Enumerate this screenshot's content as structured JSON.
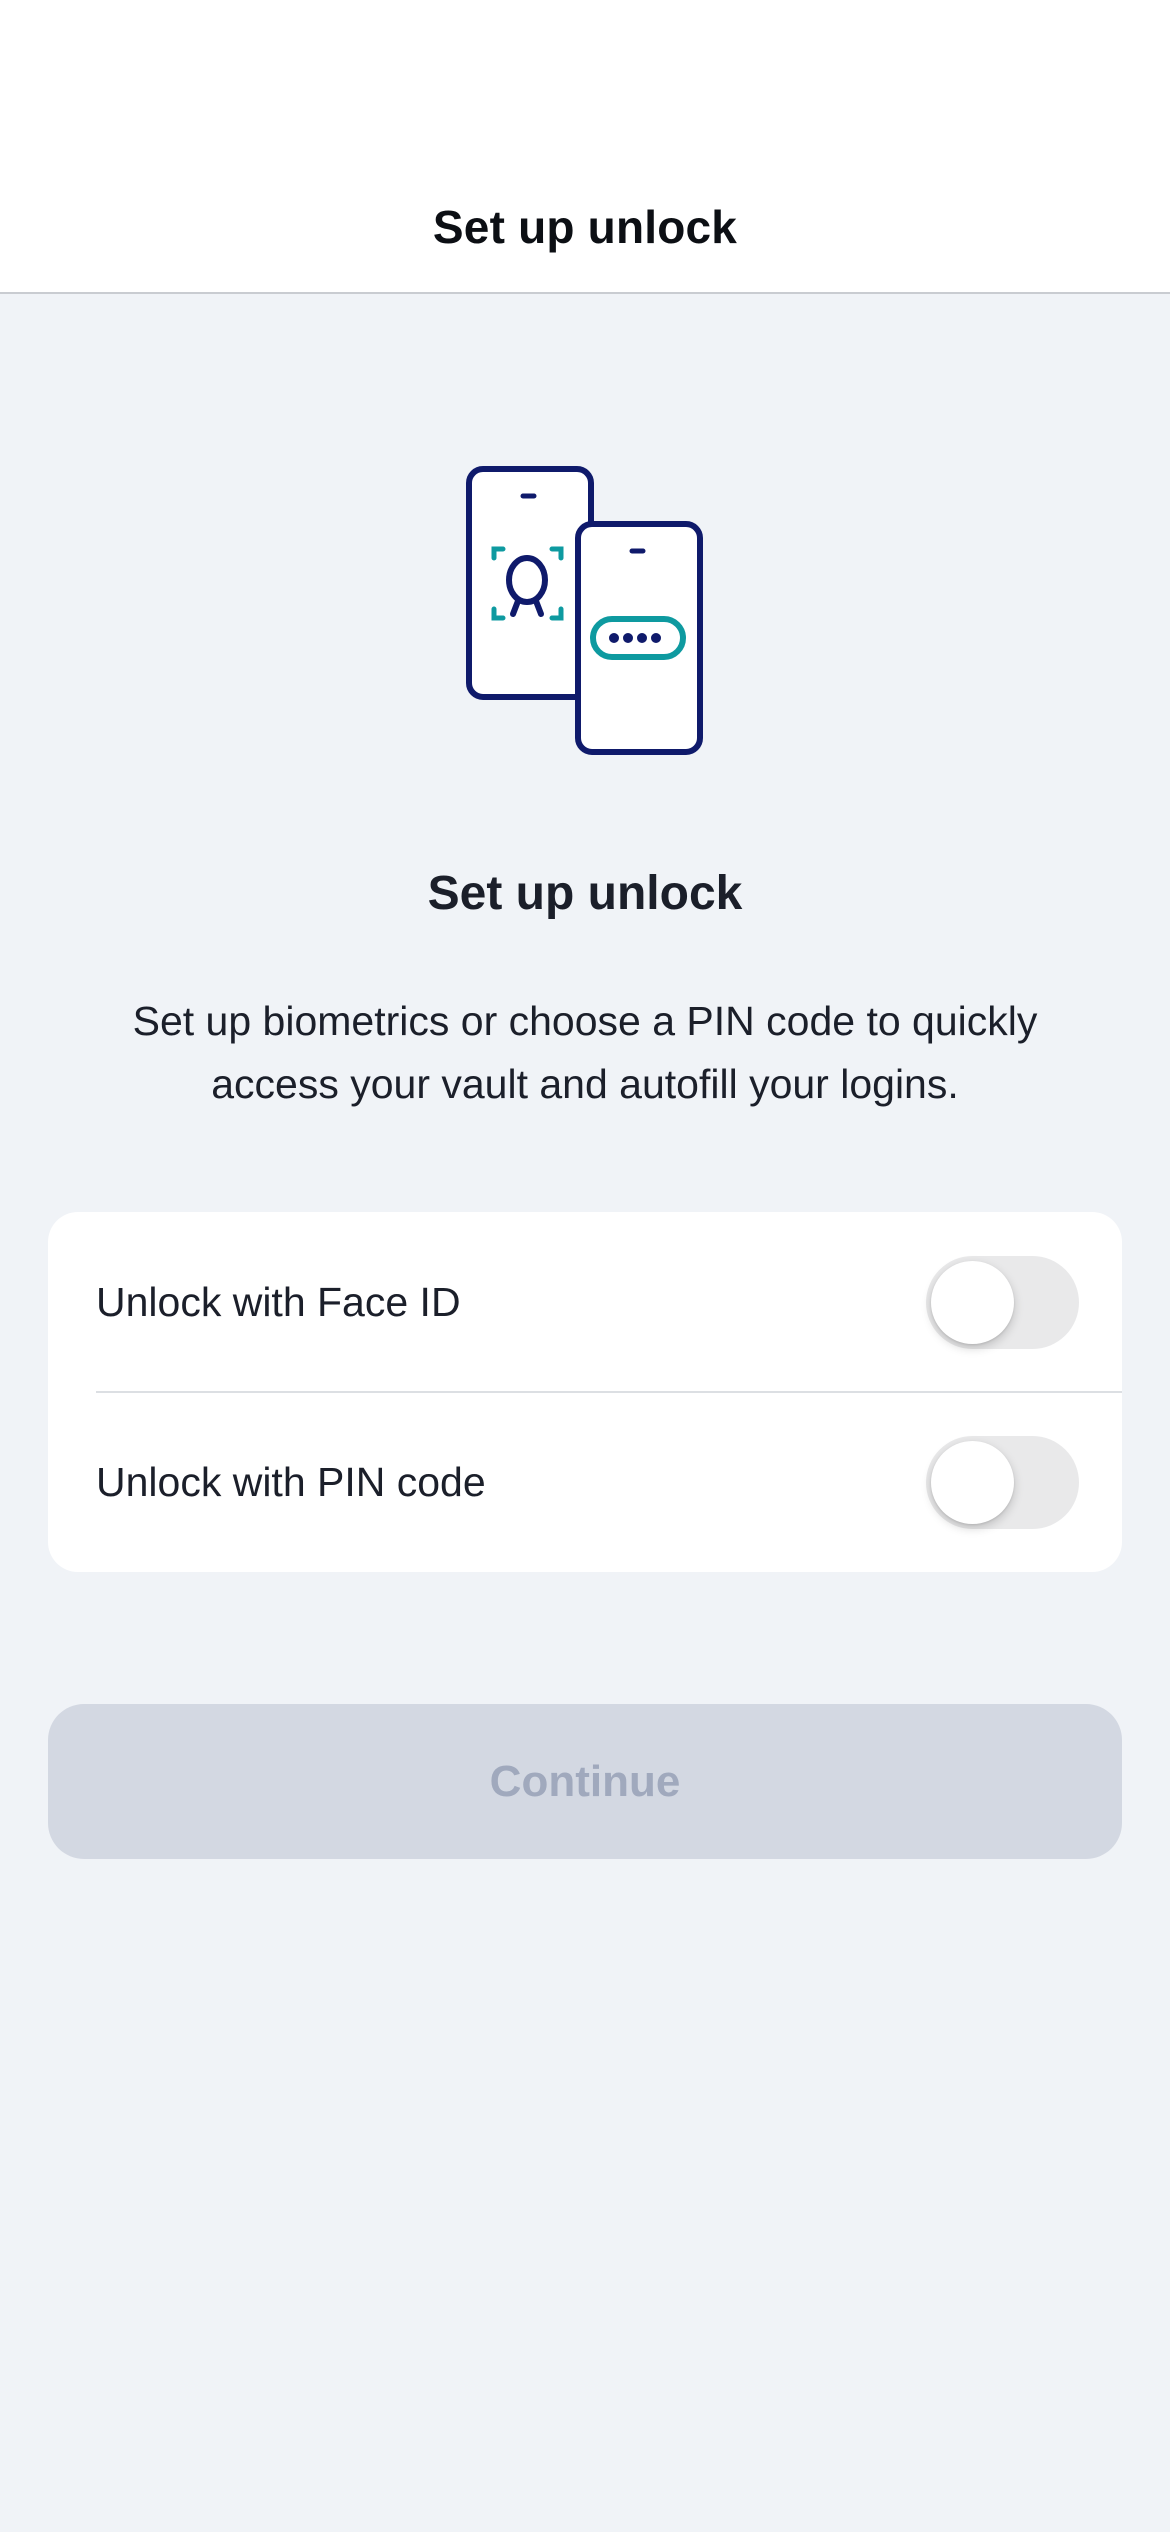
{
  "header": {
    "title": "Set up unlock"
  },
  "illustration": {
    "icon": "phones-biometric-pin-illustration",
    "colors": {
      "outline": "#0f1a6b",
      "accent": "#0e9aa0"
    }
  },
  "main": {
    "heading": "Set up unlock",
    "description": "Set up biometrics or choose a PIN code to quickly access your vault and autofill your logins."
  },
  "options": [
    {
      "label": "Unlock with Face ID",
      "enabled": false
    },
    {
      "label": "Unlock with PIN code",
      "enabled": false
    }
  ],
  "continue_button": {
    "label": "Continue",
    "state": "disabled"
  },
  "colors": {
    "background": "#f0f3f7",
    "card": "#ffffff",
    "toggle_off": "#e9e9ea",
    "button_disabled_bg": "#d3d8e2",
    "button_disabled_text": "#a0a9bd"
  }
}
